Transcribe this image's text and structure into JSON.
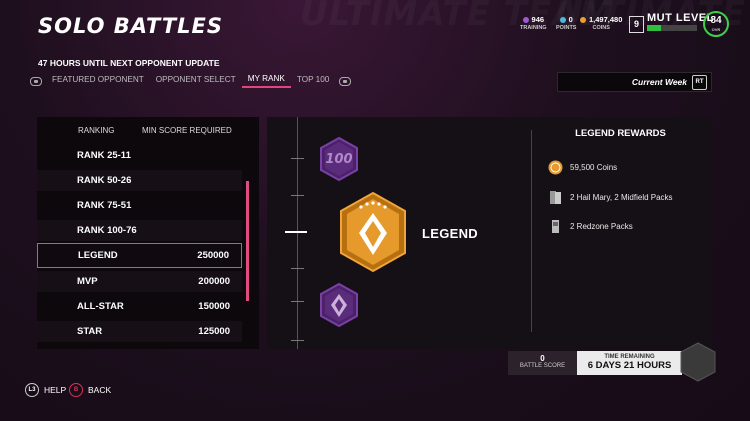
{
  "header": {
    "title": "SOLO BATTLES",
    "bg_words": [
      "ULTIMATE TEAM",
      "ULTIMATE TEAM"
    ],
    "currencies": [
      {
        "value": "946",
        "label": "TRAINING",
        "color": "#9b5ad6"
      },
      {
        "value": "0",
        "label": "POINTS",
        "color": "#4fb6e0"
      },
      {
        "value": "1,497,480",
        "label": "COINS",
        "color": "#e8a030"
      }
    ],
    "mut_level_label": "MUT LEVEL",
    "mut_level": "9",
    "mut_progress": 0.28,
    "overall": "84",
    "overall_sub": "OVR"
  },
  "subheader": "47 HOURS UNTIL NEXT OPPONENT UPDATE",
  "tabs": [
    {
      "label": "FEATURED OPPONENT",
      "active": false
    },
    {
      "label": "OPPONENT SELECT",
      "active": false
    },
    {
      "label": "MY RANK",
      "active": true
    },
    {
      "label": "TOP 100",
      "active": false
    }
  ],
  "week_selector": {
    "label": "Current Week",
    "button": "RT"
  },
  "rank_table": {
    "col_ranking": "RANKING",
    "col_min_score": "MIN SCORE REQUIRED",
    "rows": [
      {
        "rank": "RANK 25-11",
        "score": ""
      },
      {
        "rank": "RANK 50-26",
        "score": ""
      },
      {
        "rank": "RANK 75-51",
        "score": ""
      },
      {
        "rank": "RANK 100-76",
        "score": ""
      },
      {
        "rank": "LEGEND",
        "score": "250000"
      },
      {
        "rank": "MVP",
        "score": "200000"
      },
      {
        "rank": "ALL-STAR",
        "score": "150000"
      },
      {
        "rank": "STAR",
        "score": "125000"
      }
    ],
    "selected_index": 4
  },
  "rank_display": {
    "current": "LEGEND",
    "upper_badge": "100"
  },
  "rewards": {
    "title": "LEGEND REWARDS",
    "items": [
      {
        "text": "59,500 Coins",
        "icon": "coins-icon"
      },
      {
        "text": "2 Hail Mary, 2 Midfield Packs",
        "icon": "packs-icon"
      },
      {
        "text": "2 Redzone Packs",
        "icon": "pack-icon"
      }
    ]
  },
  "battle_score": {
    "value": "0",
    "label": "BATTLE SCORE"
  },
  "time_remaining": {
    "label": "TIME REMAINING",
    "value": "6 DAYS 21 HOURS"
  },
  "footer": {
    "help": {
      "key": "L3",
      "label": "HELP"
    },
    "back": {
      "key": "B",
      "label": "BACK"
    }
  },
  "colors": {
    "accent": "#e04c80",
    "legend_gold": "#e59a2b",
    "badge_purple": "#7a3fa8"
  }
}
